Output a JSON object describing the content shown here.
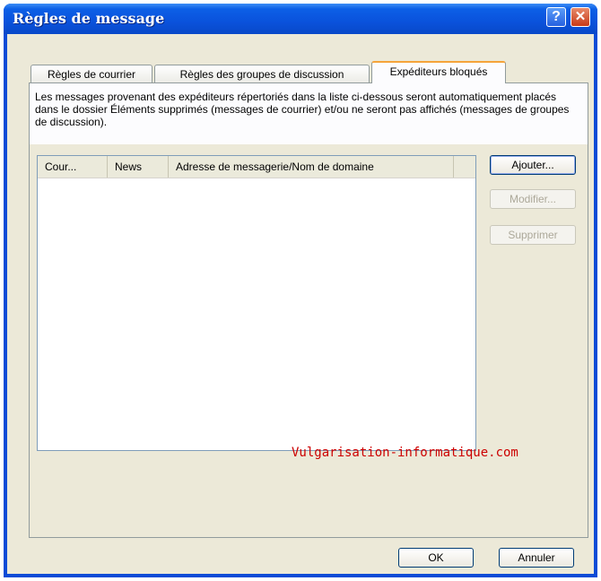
{
  "window": {
    "title": "Règles de message",
    "help_glyph": "?",
    "close_glyph": "✕"
  },
  "tabs": [
    {
      "label": "Règles de courrier"
    },
    {
      "label": "Règles des groupes de discussion"
    },
    {
      "label": "Expéditeurs bloqués"
    }
  ],
  "description": "Les messages provenant des expéditeurs répertoriés dans la liste ci-dessous seront automatiquement placés dans le dossier Éléments supprimés (messages de courrier) et/ou ne seront pas affichés (messages de groupes de discussion).",
  "list": {
    "columns": [
      {
        "label": "Cour..."
      },
      {
        "label": "News"
      },
      {
        "label": "Adresse de messagerie/Nom de domaine"
      }
    ],
    "rows": []
  },
  "actions": {
    "add": "Ajouter...",
    "modify": "Modifier...",
    "delete": "Supprimer"
  },
  "watermark": "Vulgarisation-informatique.com",
  "footer": {
    "ok": "OK",
    "cancel": "Annuler"
  }
}
